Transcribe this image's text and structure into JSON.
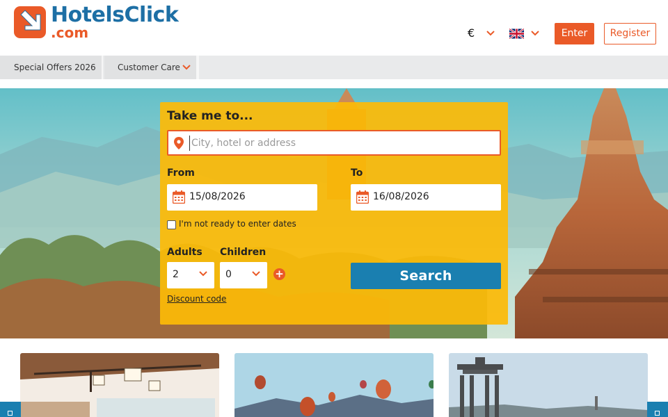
{
  "header": {
    "logo_name": "HotelsClick",
    "logo_domain": ".com",
    "currency_symbol": "€",
    "enter_label": "Enter",
    "register_label": "Register",
    "language_flag": "uk-flag-icon"
  },
  "nav": {
    "items": [
      {
        "label": "Special Offers 2026"
      },
      {
        "label": "Customer Care"
      }
    ]
  },
  "search": {
    "title": "Take me to...",
    "destination_placeholder": "City, hotel or address",
    "destination_value": "",
    "from_label": "From",
    "to_label": "To",
    "from_date": "15/08/2026",
    "to_date": "16/08/2026",
    "no_dates_label": "I'm not ready to enter dates",
    "adults_label": "Adults",
    "children_label": "Children",
    "adults_value": "2",
    "children_value": "0",
    "discount_label": "Discount code",
    "search_label": "Search"
  },
  "colors": {
    "brand_orange": "#ea5a28",
    "brand_blue": "#1d6fa5",
    "panel_yellow": "#fcba08",
    "search_blue": "#1a7fb0"
  }
}
